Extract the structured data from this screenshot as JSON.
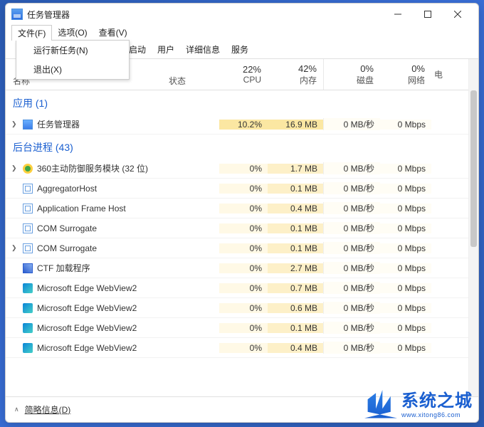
{
  "window": {
    "title": "任务管理器"
  },
  "menubar": {
    "file": "文件(F)",
    "options": "选项(O)",
    "view": "查看(V)"
  },
  "dropdown": {
    "run": "运行新任务(N)",
    "exit": "退出(X)"
  },
  "tabs": {
    "startup": "启动",
    "users": "用户",
    "details": "详细信息",
    "services": "服务"
  },
  "columns": {
    "name": "名称",
    "state": "状态",
    "cpu_pct": "22%",
    "cpu": "CPU",
    "mem_pct": "42%",
    "mem": "内存",
    "disk_pct": "0%",
    "disk": "磁盘",
    "net_pct": "0%",
    "net": "网络",
    "power": "电"
  },
  "sections": {
    "apps": "应用 (1)",
    "bg": "后台进程 (43)"
  },
  "apps": [
    {
      "name": "任务管理器",
      "cpu": "10.2%",
      "mem": "16.9 MB",
      "disk": "0 MB/秒",
      "net": "0 Mbps",
      "expandable": true,
      "icon": "tm",
      "hl": true
    }
  ],
  "bg": [
    {
      "name": "360主动防御服务模块 (32 位)",
      "cpu": "0%",
      "mem": "1.7 MB",
      "disk": "0 MB/秒",
      "net": "0 Mbps",
      "expandable": true,
      "icon": "360"
    },
    {
      "name": "AggregatorHost",
      "cpu": "0%",
      "mem": "0.1 MB",
      "disk": "0 MB/秒",
      "net": "0 Mbps",
      "icon": "win"
    },
    {
      "name": "Application Frame Host",
      "cpu": "0%",
      "mem": "0.4 MB",
      "disk": "0 MB/秒",
      "net": "0 Mbps",
      "icon": "win"
    },
    {
      "name": "COM Surrogate",
      "cpu": "0%",
      "mem": "0.1 MB",
      "disk": "0 MB/秒",
      "net": "0 Mbps",
      "icon": "win"
    },
    {
      "name": "COM Surrogate",
      "cpu": "0%",
      "mem": "0.1 MB",
      "disk": "0 MB/秒",
      "net": "0 Mbps",
      "expandable": true,
      "icon": "win"
    },
    {
      "name": "CTF 加载程序",
      "cpu": "0%",
      "mem": "2.7 MB",
      "disk": "0 MB/秒",
      "net": "0 Mbps",
      "icon": "ctf"
    },
    {
      "name": "Microsoft Edge WebView2",
      "cpu": "0%",
      "mem": "0.7 MB",
      "disk": "0 MB/秒",
      "net": "0 Mbps",
      "icon": "edge"
    },
    {
      "name": "Microsoft Edge WebView2",
      "cpu": "0%",
      "mem": "0.6 MB",
      "disk": "0 MB/秒",
      "net": "0 Mbps",
      "icon": "edge"
    },
    {
      "name": "Microsoft Edge WebView2",
      "cpu": "0%",
      "mem": "0.1 MB",
      "disk": "0 MB/秒",
      "net": "0 Mbps",
      "icon": "edge"
    },
    {
      "name": "Microsoft Edge WebView2",
      "cpu": "0%",
      "mem": "0.4 MB",
      "disk": "0 MB/秒",
      "net": "0 Mbps",
      "icon": "edge"
    }
  ],
  "footer": {
    "brief": "简略信息(D)"
  },
  "watermark": {
    "text": "系统之城",
    "sub": "www.xitong86.com"
  }
}
